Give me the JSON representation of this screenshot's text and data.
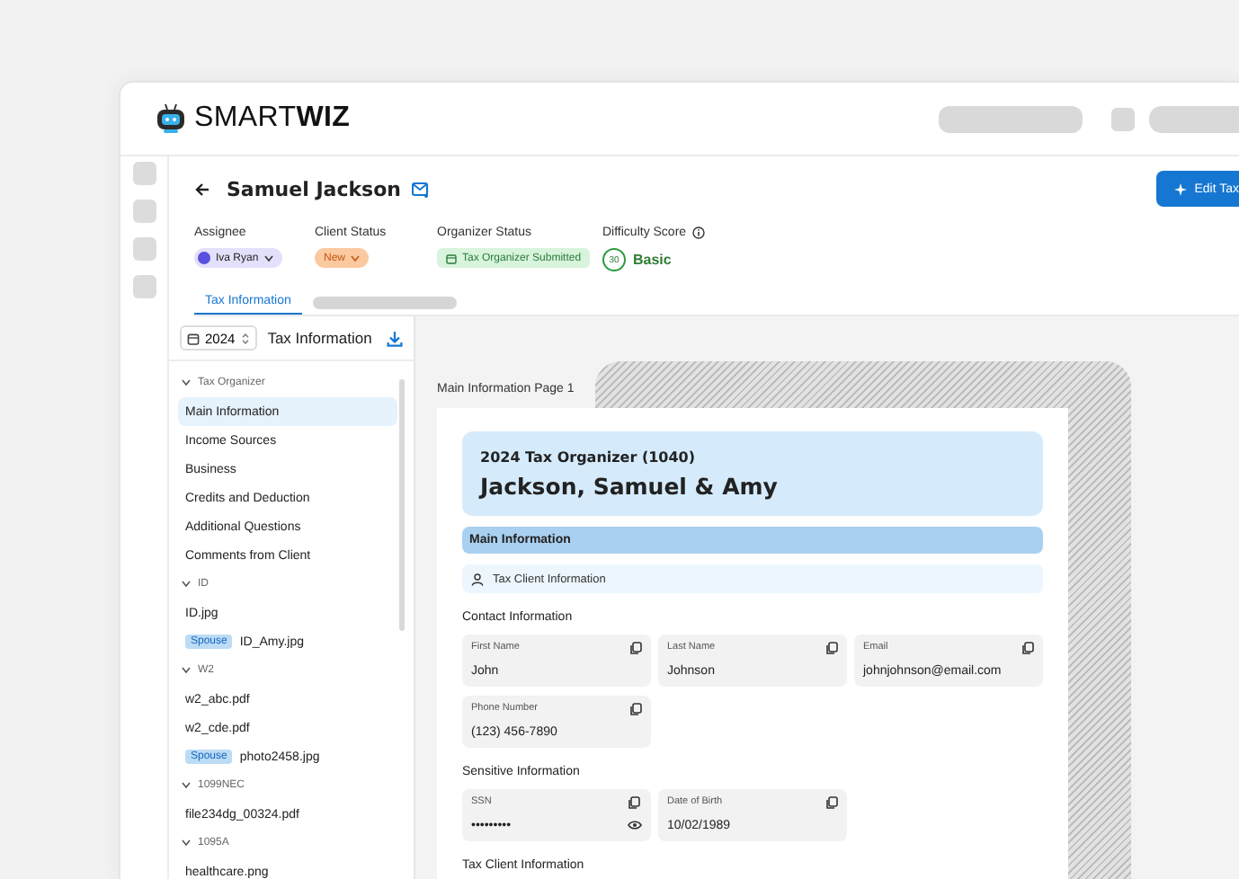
{
  "app": {
    "logo": "SMART**WIZ**"
  },
  "client": {
    "name": "Samuel Jackson"
  },
  "action_button": {
    "label": "Edit Tax"
  },
  "fields": [
    {
      "kind": "assignee",
      "label": "Assignee",
      "value": "Iva Ryan"
    },
    {
      "kind": "status",
      "label": "Client Status",
      "value": "New"
    },
    {
      "kind": "organizer",
      "label": "Organizer Status",
      "value": "Tax Organizer Submitted"
    },
    {
      "kind": "score",
      "label": "Difficulty Score",
      "score": "30",
      "value": "Basic"
    }
  ],
  "tabs": [
    {
      "label": "Tax Information",
      "selected": true
    }
  ],
  "sidebar": {
    "year": "2024",
    "title": "Tax Information",
    "groups": [
      {
        "label": "Tax Organizer",
        "expanded": true,
        "children": [
          {
            "label": "Main Information",
            "selected": true
          },
          {
            "label": "Income Sources",
            "selected": false
          },
          {
            "label": "Business",
            "selected": false
          },
          {
            "label": "Credits and Deduction",
            "selected": false
          },
          {
            "label": "Additional Questions",
            "selected": false
          },
          {
            "label": "Comments from Client",
            "selected": false
          }
        ]
      },
      {
        "label": "ID",
        "expanded": true,
        "children": [
          {
            "label": "ID.jpg",
            "selected": false
          },
          {
            "label": "ID_Amy.jpg",
            "tag": "Spouse",
            "selected": false
          }
        ]
      },
      {
        "label": "W2",
        "expanded": true,
        "children": [
          {
            "label": "w2_abc.pdf",
            "selected": false
          },
          {
            "label": "w2_cde.pdf",
            "selected": false
          },
          {
            "label": "photo2458.jpg",
            "tag": "Spouse",
            "selected": false
          }
        ]
      },
      {
        "label": "1099NEC",
        "expanded": true,
        "children": [
          {
            "label": "file234dg_00324.pdf",
            "selected": false
          }
        ]
      },
      {
        "label": "1095A",
        "expanded": true,
        "children": [
          {
            "label": "healthcare.png",
            "selected": false
          }
        ]
      }
    ]
  },
  "document": {
    "page_label": "Main Information Page 1",
    "subtitle": "2024 Tax Organizer (1040)",
    "title": "Jackson, Samuel & Amy",
    "section": "Main Information",
    "subsection": "Tax Client Information",
    "groups": [
      {
        "heading": "Contact Information",
        "fields": [
          {
            "label": "First Name",
            "value": "John",
            "masked": false
          },
          {
            "label": "Last Name",
            "value": "Johnson",
            "masked": false
          },
          {
            "label": "Email",
            "value": "johnjohnson@email.com",
            "masked": false
          },
          {
            "label": "Phone Number",
            "value": "(123) 456-7890",
            "masked": false
          }
        ]
      },
      {
        "heading": "Sensitive Information",
        "fields": [
          {
            "label": "SSN",
            "value": "•••••••••",
            "masked": true
          },
          {
            "label": "Date of Birth",
            "value": "10/02/1989",
            "masked": false
          }
        ]
      },
      {
        "heading": "Tax Client Information"
      }
    ]
  }
}
